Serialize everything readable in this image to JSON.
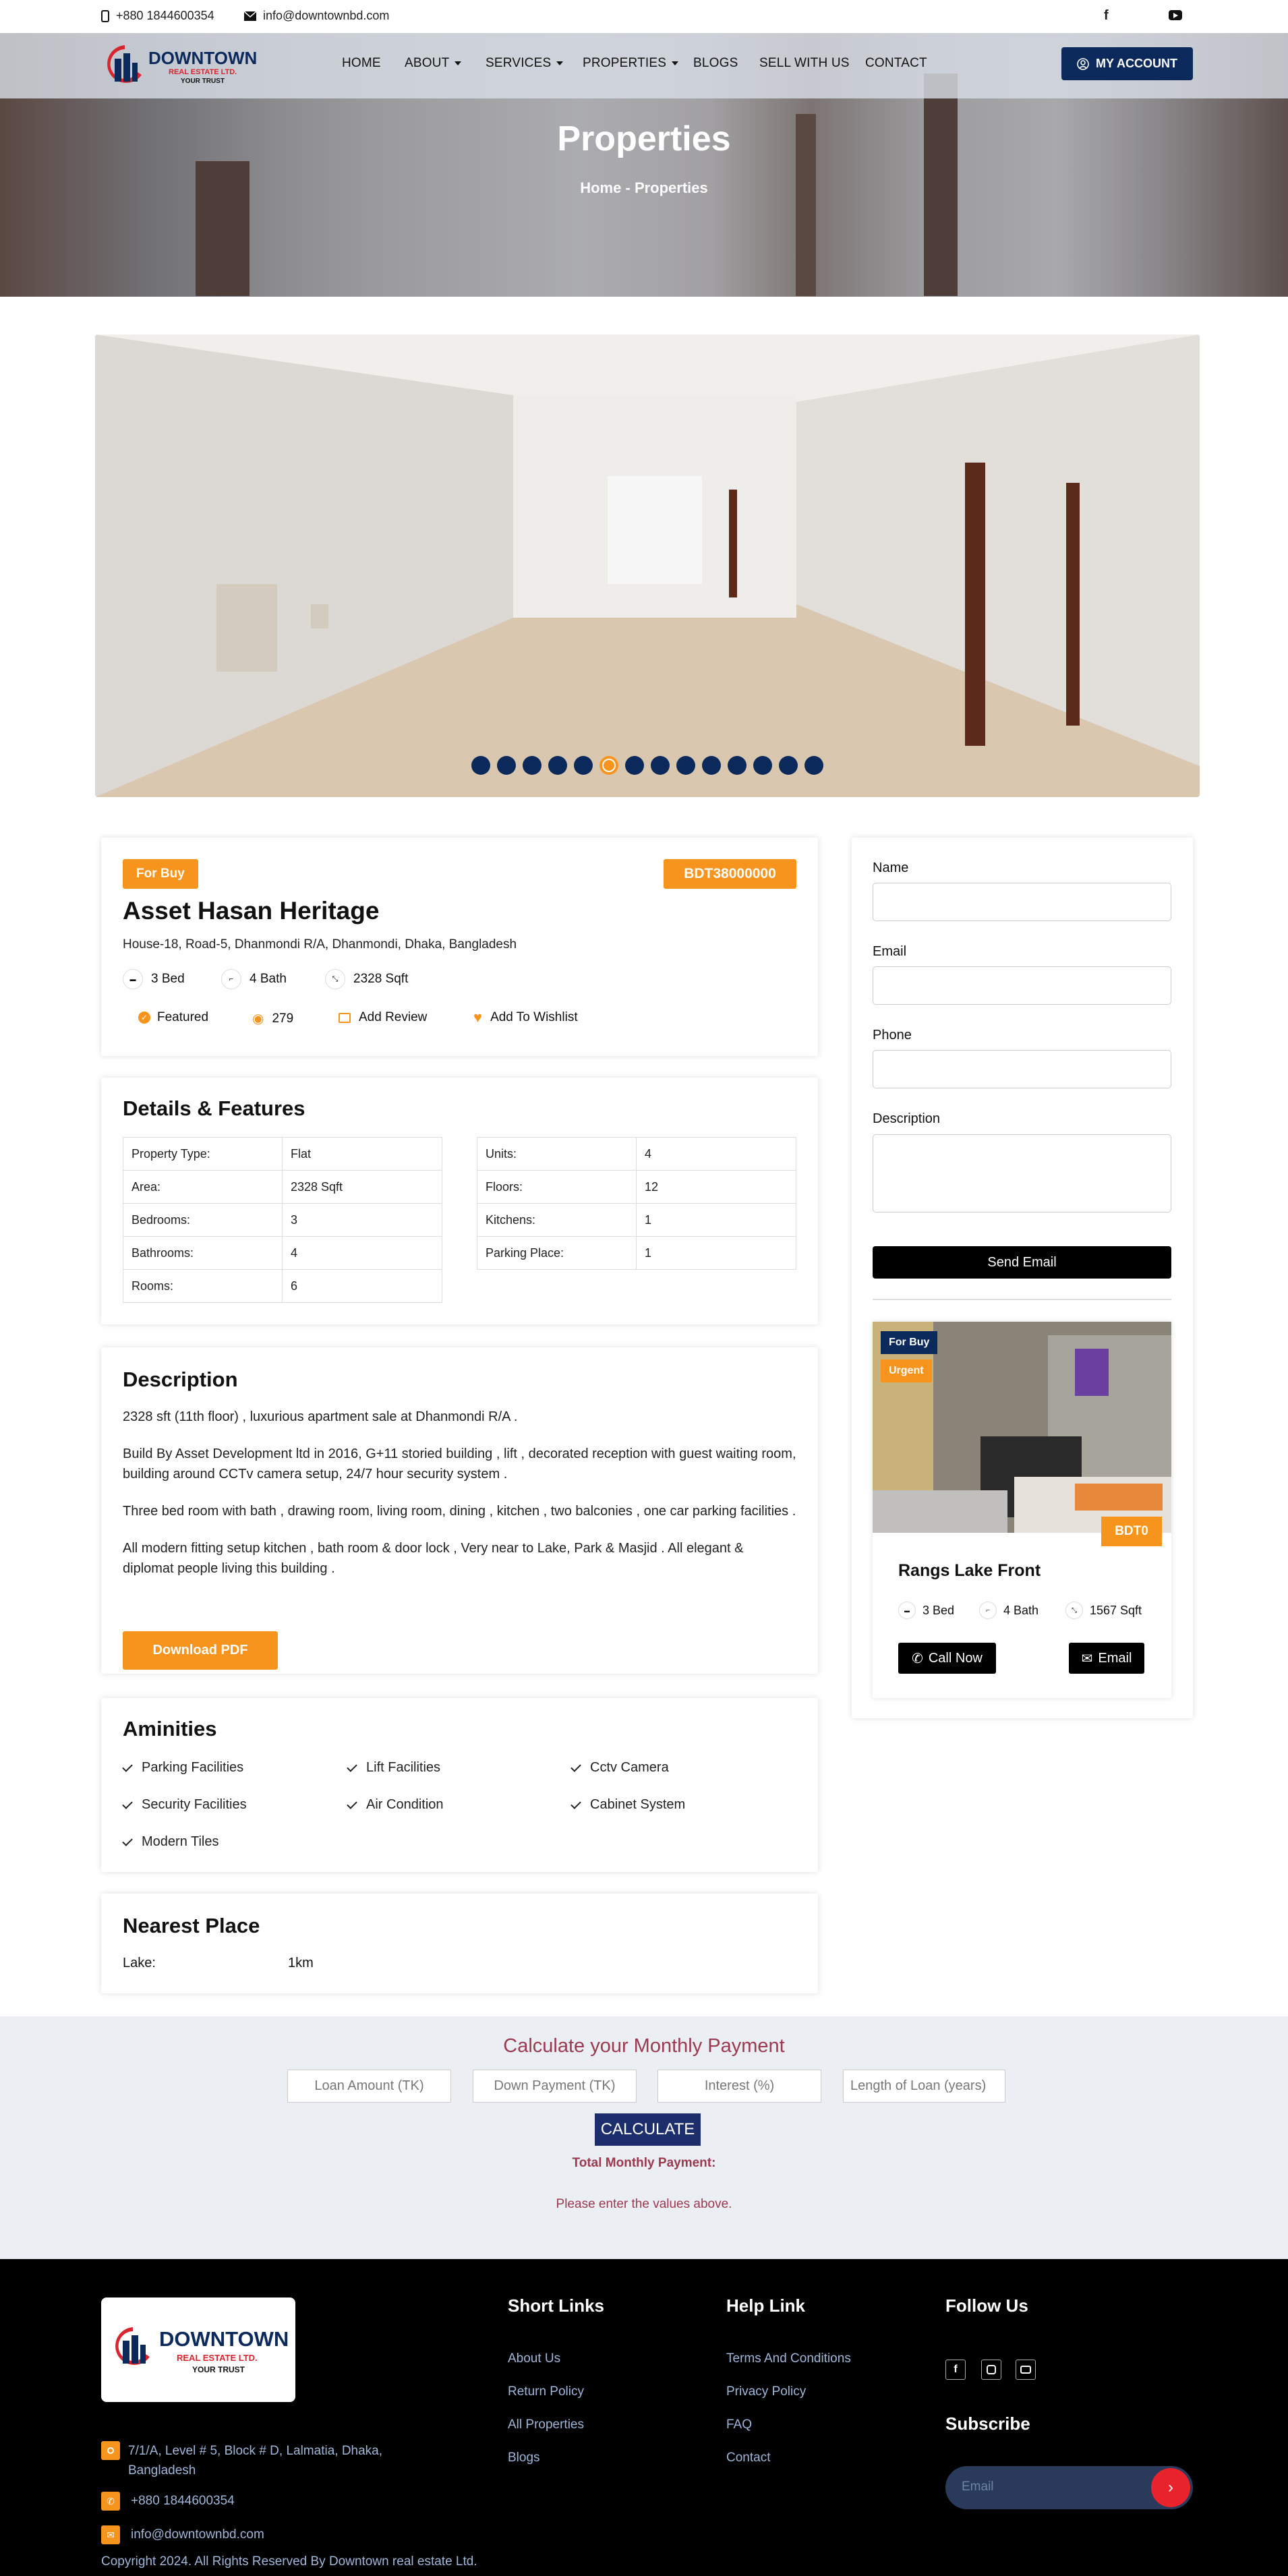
{
  "topbar": {
    "phone": "+880 1844600354",
    "email": "info@downtownbd.com",
    "social": [
      "facebook-icon",
      "youtube-icon"
    ]
  },
  "brand": {
    "name": "DOWNTOWN",
    "sub": "REAL ESTATE LTD.",
    "tagline": "YOUR TRUST"
  },
  "nav": {
    "items": [
      "HOME",
      "ABOUT",
      "SERVICES",
      "PROPERTIES",
      "BLOGS",
      "SELL WITH US",
      "CONTACT"
    ],
    "account": "MY ACCOUNT"
  },
  "hero": {
    "title": "Properties",
    "crumb_home": "Home",
    "crumb_sep": "-",
    "crumb_current": "Properties"
  },
  "slider": {
    "dot_count": 14,
    "active_dot": 5
  },
  "property": {
    "tag": "For Buy",
    "price": "BDT38000000",
    "title": "Asset Hasan Heritage",
    "address": "House-18, Road-5, Dhanmondi R/A, Dhanmondi, Dhaka, Bangladesh",
    "bed": "3 Bed",
    "bath": "4 Bath",
    "area": "2328 Sqft",
    "featured": "Featured",
    "views": "279",
    "add_review": "Add Review",
    "wishlist": "Add To Wishlist"
  },
  "details": {
    "title": "Details & Features",
    "left": [
      [
        "Property Type:",
        "Flat"
      ],
      [
        "Area:",
        "2328 Sqft"
      ],
      [
        "Bedrooms:",
        "3"
      ],
      [
        "Bathrooms:",
        "4"
      ],
      [
        "Rooms:",
        "6"
      ]
    ],
    "right": [
      [
        "Units:",
        "4"
      ],
      [
        "Floors:",
        "12"
      ],
      [
        "Kitchens:",
        "1"
      ],
      [
        "Parking Place:",
        "1"
      ]
    ]
  },
  "description": {
    "title": "Description",
    "p1": "2328 sft (11th floor) , luxurious apartment sale at Dhanmondi R/A .",
    "p2": "Build By Asset Development ltd in 2016, G+11 storied building ,  lift , decorated reception with guest waiting room, building around CCTv camera setup, 24/7 hour security system .",
    "p3": "Three  bed room with bath , drawing room, living room,  dining , kitchen , two balconies , one car parking facilities .",
    "p4": "All modern fitting setup kitchen , bath room  & door lock ,  Very near to Lake, Park & Masjid . All elegant & diplomat people living this building .",
    "pdf": "Download PDF"
  },
  "amenities": {
    "title": "Aminities",
    "items": [
      "Parking Facilities",
      "Lift Facilities",
      "Cctv Camera",
      "Security Facilities",
      "Air Condition",
      "Cabinet System",
      "Modern Tiles"
    ]
  },
  "nearest": {
    "title": "Nearest Place",
    "label": "Lake:",
    "value": "1km"
  },
  "contact_form": {
    "name": "Name",
    "email": "Email",
    "phone": "Phone",
    "description": "Description",
    "send": "Send Email"
  },
  "related": {
    "tag1": "For Buy",
    "tag2": "Urgent",
    "price": "BDT0",
    "title": "Rangs Lake Front",
    "bed": "3 Bed",
    "bath": "4 Bath",
    "area": "1567 Sqft",
    "call": "Call Now",
    "email": "Email"
  },
  "calculator": {
    "title": "Calculate your Monthly Payment",
    "placeholders": [
      "Loan Amount (TK)",
      "Down Payment (TK)",
      "Interest (%)",
      "Length of Loan (years)"
    ],
    "button": "CALCULATE",
    "total": "Total Monthly Payment:",
    "note": "Please enter the values above."
  },
  "footer": {
    "address": "7/1/A, Level # 5, Block # D, Lalmatia, Dhaka, Bangladesh",
    "phone": "+880 1844600354",
    "email": "info@downtownbd.com",
    "copyright": "Copyright 2024. All Rights Reserved By Downtown real estate Ltd.",
    "short_links_title": "Short Links",
    "short_links": [
      "About Us",
      "Return Policy",
      "All Properties",
      "Blogs"
    ],
    "help_title": "Help Link",
    "help_links": [
      "Terms And Conditions",
      "Privacy Policy",
      "FAQ",
      "Contact"
    ],
    "follow_title": "Follow Us",
    "subscribe_title": "Subscribe",
    "subscribe_placeholder": "Email"
  },
  "colors": {
    "orange": "#f7941d",
    "navy": "#0b2a5b",
    "calc_title": "#9b3a4f",
    "brand_red": "#d7262f"
  }
}
